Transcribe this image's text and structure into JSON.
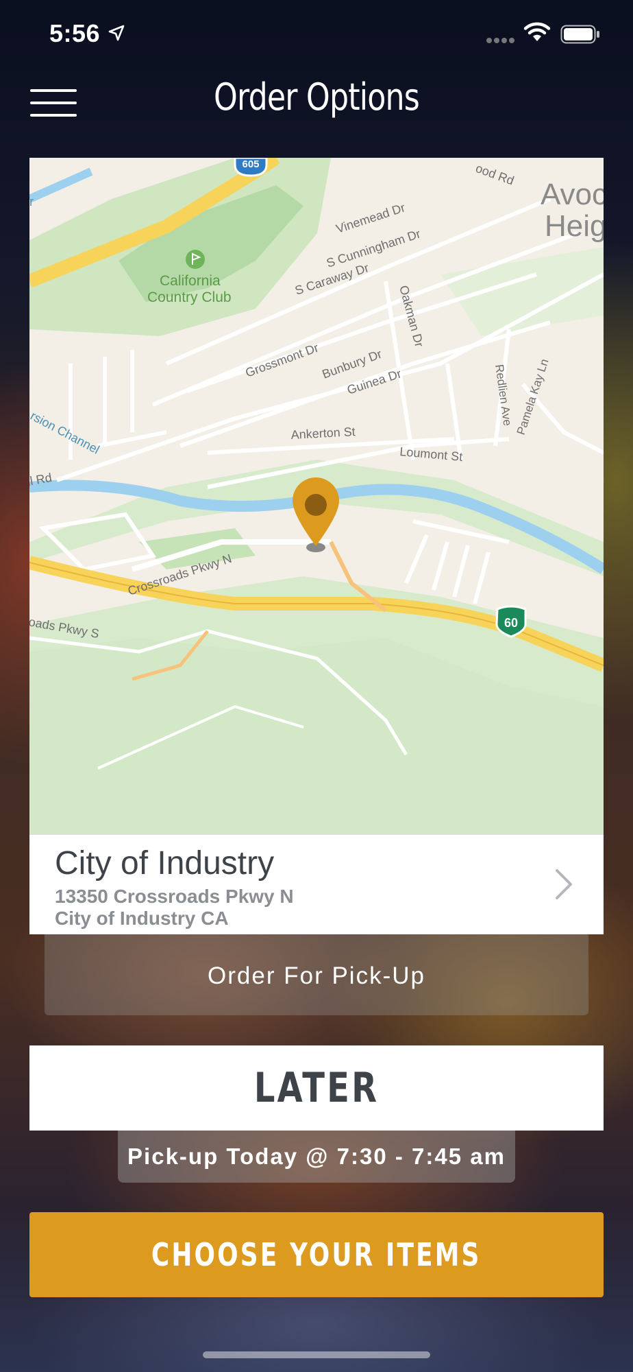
{
  "status_bar": {
    "time": "5:56"
  },
  "header": {
    "title": "Order Options",
    "menu_icon": "hamburger-menu-icon"
  },
  "map": {
    "labels": {
      "california_country_club_1": "California",
      "california_country_club_2": "Country Club",
      "vinemead": "Vinemead Dr",
      "s_cunningham": "S Cunningham Dr",
      "s_caraway": "S Caraway Dr",
      "oakman": "Oakman Dr",
      "grossmont": "Grossmont Dr",
      "bunbury": "Bunbury Dr",
      "guinea": "Guinea Dr",
      "redlien": "Redlien Ave",
      "pamela_kay": "Pamela Kay Ln",
      "ankerton": "Ankerton St",
      "loumont": "Loumont St",
      "avocado_1": "Avoc",
      "avocado_2": "Heig",
      "wood_rd": "ood Rd",
      "diversion": "rsion Channel",
      "hill_rd": "ll Rd",
      "crossroads_n": "Crossroads Pkwy N",
      "crossroads_s": "oads Pkwy S",
      "shield_605": "605",
      "shield_60": "60",
      "r_edge": "r"
    },
    "pin_icon": "map-pin-icon"
  },
  "location": {
    "name": "City of Industry",
    "address_line1": "13350 Crossroads Pkwy N",
    "address_line2": "City of Industry CA",
    "chevron_icon": "chevron-right-icon"
  },
  "order_type": "Order For Pick-Up",
  "timing_button": "LATER",
  "pickup_time": "Pick-up Today @ 7:30 - 7:45 am",
  "cta_button": "CHOOSE YOUR ITEMS",
  "colors": {
    "accent": "#dc9b1e",
    "card_text": "#3e4249",
    "secondary_text": "#8a8d92"
  }
}
